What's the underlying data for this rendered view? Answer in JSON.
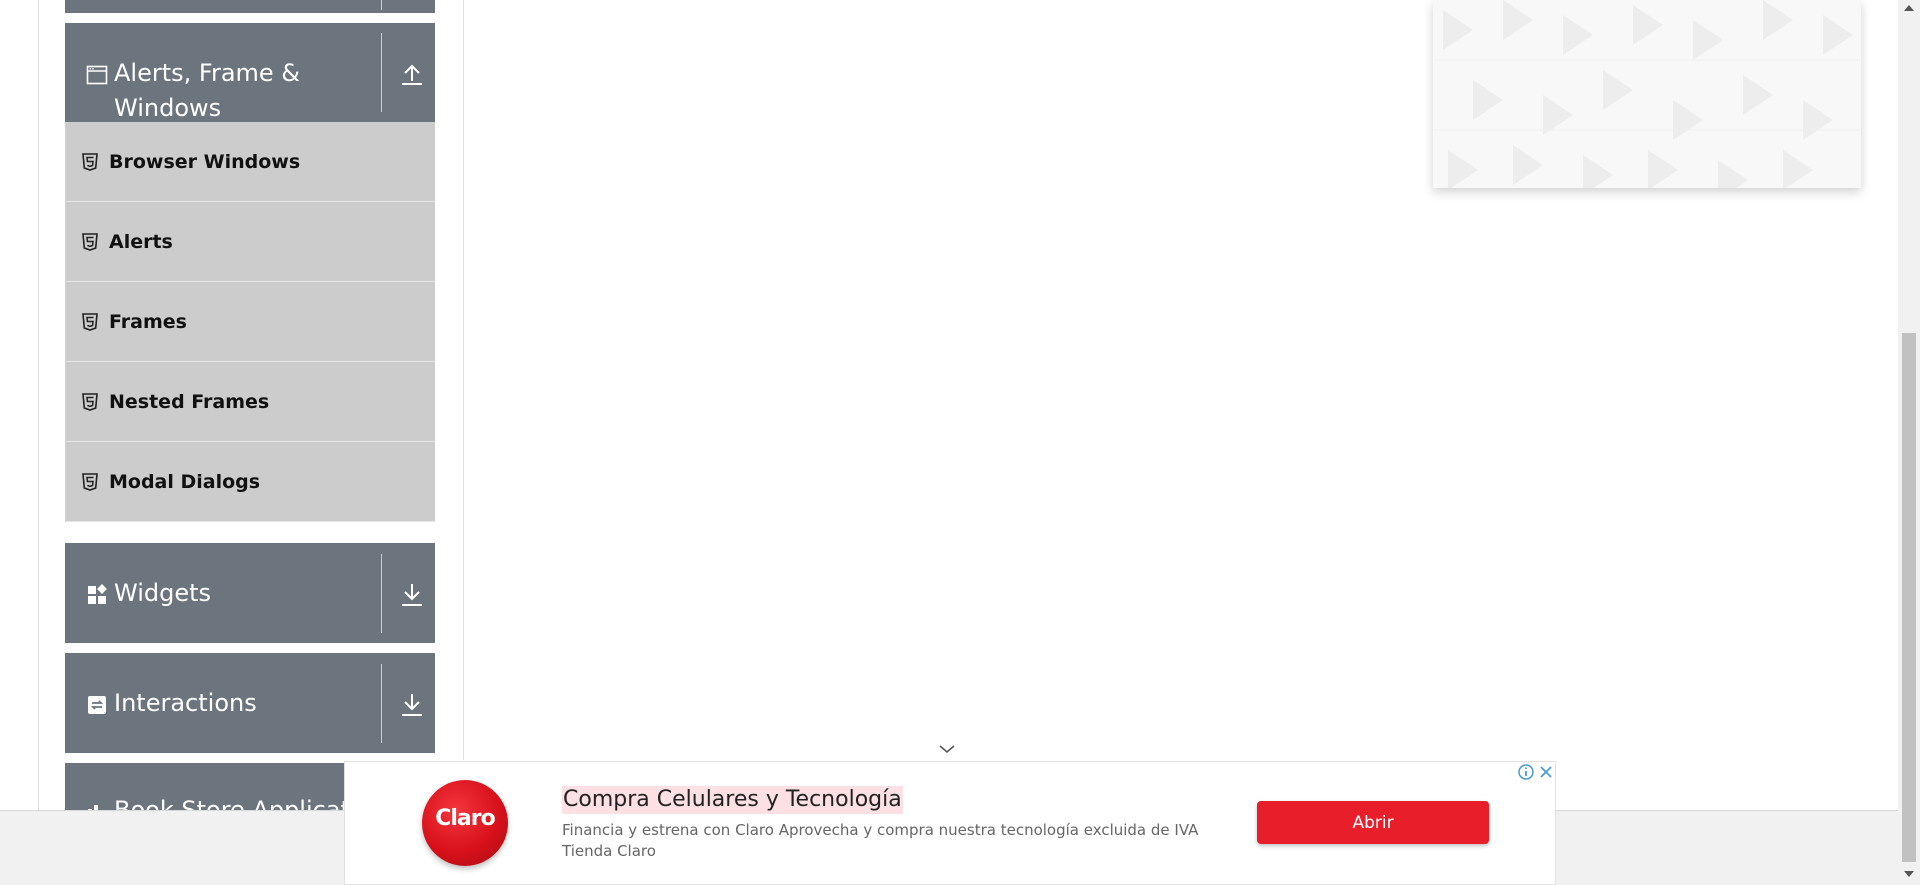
{
  "sidebar": {
    "groups": {
      "alerts": {
        "title_line1": "Alerts, Frame &",
        "title_line2": "Windows",
        "icon": "window-icon",
        "toggle": "collapse-up-icon"
      },
      "widgets": {
        "title": "Widgets",
        "icon": "widgets-icon",
        "toggle": "expand-down-icon"
      },
      "interactions": {
        "title": "Interactions",
        "icon": "interactions-icon",
        "toggle": "expand-down-icon"
      },
      "bookstore": {
        "title": "Book Store Applicatio",
        "icon": "bookstore-icon"
      }
    },
    "items": [
      {
        "label": "Browser Windows",
        "icon": "html5-icon"
      },
      {
        "label": "Alerts",
        "icon": "html5-icon"
      },
      {
        "label": "Frames",
        "icon": "html5-icon"
      },
      {
        "label": "Nested Frames",
        "icon": "html5-icon"
      },
      {
        "label": "Modal Dialogs",
        "icon": "html5-icon"
      }
    ]
  },
  "ad": {
    "logo_text": "Claro",
    "headline": "Compra Celulares y Tecnología",
    "description": "Financia y estrena con Claro Aprovecha y compra nuestra tecnología excluida de IVA",
    "sponsor": "Tienda Claro",
    "button_label": "Abrir"
  },
  "colors": {
    "group_header": "#6c757d",
    "menu_item": "#cccccc",
    "ad_button": "#e81e2a"
  }
}
